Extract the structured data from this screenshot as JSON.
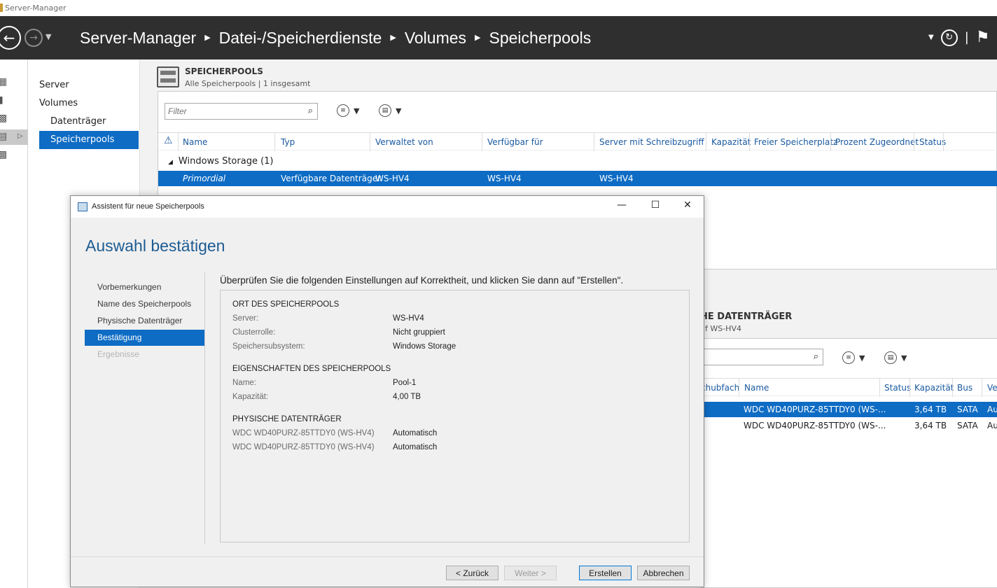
{
  "window": {
    "title": "Server-Manager"
  },
  "header": {
    "breadcrumb": [
      "Server-Manager",
      "Datei-/Speicherdienste",
      "Volumes",
      "Speicherpools"
    ]
  },
  "subnav": {
    "items": [
      "Server",
      "Volumes",
      "Datenträger",
      "Speicherpools"
    ],
    "selected": "Speicherpools"
  },
  "pools": {
    "title": "SPEICHERPOOLS",
    "subtitle": "Alle Speicherpools | 1 insgesamt",
    "filter_placeholder": "Filter",
    "columns": [
      "Name",
      "Typ",
      "Verwaltet von",
      "Verfügbar für",
      "Server mit Schreibzugriff",
      "Kapazität",
      "Freier Speicherplatz",
      "Prozent Zugeordnet",
      "Status"
    ],
    "group": "Windows Storage (1)",
    "row": {
      "name": "Primordial",
      "type": "Verfügbare Datenträger",
      "managed_by": "WS-HV4",
      "available_for": "WS-HV4",
      "write_server": "WS-HV4"
    }
  },
  "disks": {
    "title": "HE DATENTRÄGER",
    "subtitle": "uf WS-HV4",
    "columns": [
      "chubfach",
      "Name",
      "Status",
      "Kapazität",
      "Bus",
      "Ve"
    ],
    "rows": [
      {
        "name": "WDC WD40PURZ-85TTDY0 (WS-...",
        "capacity": "3,64 TB",
        "bus": "SATA",
        "ve": "Au"
      },
      {
        "name": "WDC WD40PURZ-85TTDY0 (WS-...",
        "capacity": "3,64 TB",
        "bus": "SATA",
        "ve": "Au"
      }
    ]
  },
  "dialog": {
    "title": "Assistent für neue Speicherpools",
    "heading": "Auswahl bestätigen",
    "steps": [
      "Vorbemerkungen",
      "Name des Speicherpools",
      "Physische Datenträger",
      "Bestätigung",
      "Ergebnisse"
    ],
    "instruction": "Überprüfen Sie die folgenden Einstellungen auf Korrektheit, und klicken Sie dann auf \"Erstellen\".",
    "sections": {
      "location": {
        "title": "ORT DES SPEICHERPOOLS",
        "rows": [
          {
            "label": "Server:",
            "value": "WS-HV4"
          },
          {
            "label": "Clusterrolle:",
            "value": "Nicht gruppiert"
          },
          {
            "label": "Speichersubsystem:",
            "value": "Windows Storage"
          }
        ]
      },
      "properties": {
        "title": "EIGENSCHAFTEN DES SPEICHERPOOLS",
        "rows": [
          {
            "label": "Name:",
            "value": "Pool-1"
          },
          {
            "label": "Kapazität:",
            "value": "4,00 TB"
          }
        ]
      },
      "physical": {
        "title": "PHYSISCHE DATENTRÄGER",
        "rows": [
          {
            "label": "WDC WD40PURZ-85TTDY0 (WS-HV4)",
            "value": "Automatisch"
          },
          {
            "label": "WDC WD40PURZ-85TTDY0 (WS-HV4)",
            "value": "Automatisch"
          }
        ]
      }
    },
    "buttons": {
      "back": "< Zurück",
      "next": "Weiter >",
      "create": "Erstellen",
      "cancel": "Abbrechen"
    }
  }
}
